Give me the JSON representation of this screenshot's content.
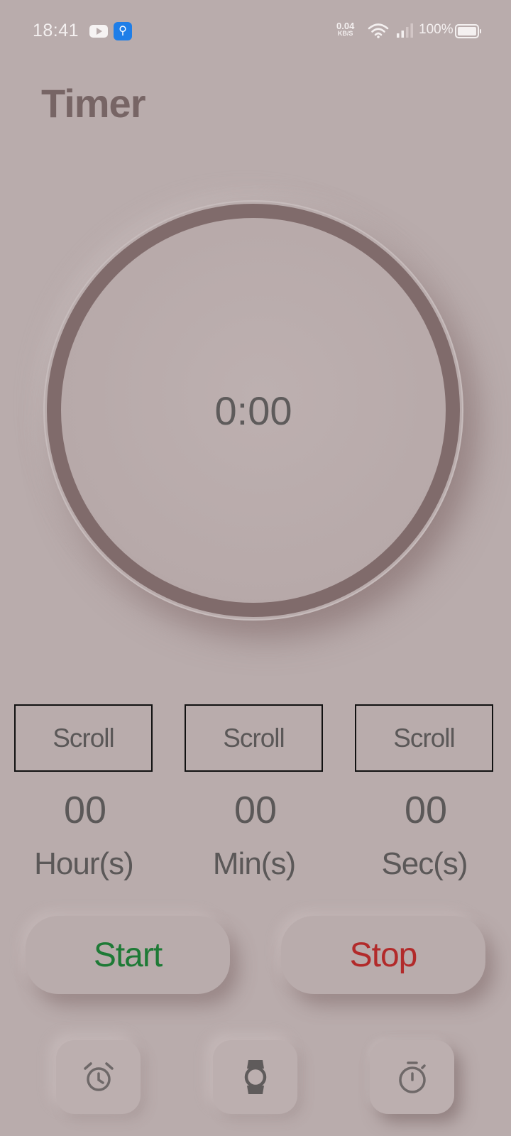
{
  "status_bar": {
    "time": "18:41",
    "net_speed_value": "0.04",
    "net_speed_unit": "KB/S",
    "battery": "100%",
    "icons": [
      "youtube-icon",
      "usb-icon",
      "wifi-icon",
      "signal-icon",
      "battery-icon"
    ]
  },
  "header": {
    "title": "Timer"
  },
  "dial": {
    "display": "0:00",
    "ring_color": "#806b6b"
  },
  "pickers": [
    {
      "button_label": "Scroll",
      "value": "00",
      "unit": "Hour(s)"
    },
    {
      "button_label": "Scroll",
      "value": "00",
      "unit": "Min(s)"
    },
    {
      "button_label": "Scroll",
      "value": "00",
      "unit": "Sec(s)"
    }
  ],
  "actions": {
    "start_label": "Start",
    "start_color": "#1e7a36",
    "stop_label": "Stop",
    "stop_color": "#b22a2a"
  },
  "nav": {
    "items": [
      {
        "icon": "alarm-clock-icon",
        "selected": false
      },
      {
        "icon": "watch-icon",
        "selected": false
      },
      {
        "icon": "stopwatch-icon",
        "selected": true
      }
    ]
  },
  "colors": {
    "background": "#b9acac",
    "text": "#5b5858",
    "title": "#776565"
  }
}
